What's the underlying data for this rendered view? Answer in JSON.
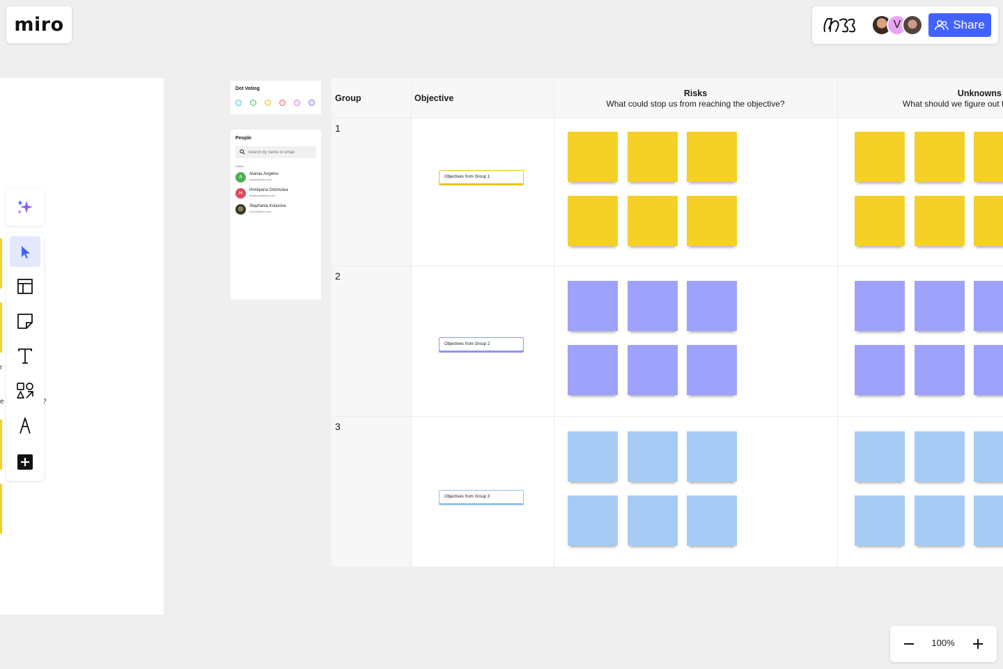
{
  "app": {
    "logo_text": "miro"
  },
  "colors": {
    "accent": "#4262ff",
    "sticky_yellow": "#f5d128",
    "sticky_purple": "#9ea2fa",
    "sticky_blue": "#a6ccf5",
    "canvas_bg": "#efefef"
  },
  "header": {
    "board_icon": "board-doodle-icon",
    "collaborators": [
      {
        "name": "collaborator-1",
        "initial": ""
      },
      {
        "name": "collaborator-2",
        "initial": "V"
      },
      {
        "name": "collaborator-3",
        "initial": ""
      }
    ],
    "share_label": "Share",
    "share_icon": "people-icon"
  },
  "toolbar": {
    "ai_icon": "sparkle-icon",
    "tools": [
      {
        "name": "select-tool",
        "icon": "cursor-icon",
        "active": true
      },
      {
        "name": "templates-tool",
        "icon": "template-icon",
        "active": false
      },
      {
        "name": "sticky-note-tool",
        "icon": "sticky-note-icon",
        "active": false
      },
      {
        "name": "text-tool",
        "icon": "text-icon",
        "active": false
      },
      {
        "name": "shapes-tool",
        "icon": "shapes-icon",
        "active": false
      },
      {
        "name": "pen-tool",
        "icon": "pen-icon",
        "active": false
      },
      {
        "name": "more-tools",
        "icon": "plus-square-icon",
        "active": false
      }
    ]
  },
  "left_frame": {
    "fragment_1": "r",
    "fragment_2": "e s",
    "fragment_3": "?"
  },
  "dot_voting": {
    "title": "Dot Voting",
    "dots": [
      "#5bc0de",
      "#4cbf6b",
      "#e0c229",
      "#ef6b6b",
      "#e07be0",
      "#7b7bef"
    ]
  },
  "people": {
    "title": "People",
    "search_placeholder": "Search by name or email",
    "online_label": "Online",
    "list": [
      {
        "initial": "A",
        "name": "Atanas Angelov",
        "email": "atanas@miro.com",
        "color": "#4cb050"
      },
      {
        "initial": "H",
        "name": "Hristiyana Ostrovska",
        "email": "hristiyana@miro.com",
        "color": "#e0485e"
      },
      {
        "initial": "",
        "name": "Stephania Kolarova",
        "email": "s1212@miro.com",
        "color": "#3a4a2a"
      }
    ]
  },
  "table": {
    "headers": {
      "group": "Group",
      "objective": "Objective",
      "risks_title": "Risks",
      "risks_sub": "What could stop us from reaching the objective?",
      "unknowns_title": "Unknowns",
      "unknowns_sub": "What should we figure out to"
    },
    "rows": [
      {
        "num": "1",
        "objective": "Objectives from Group 1",
        "color": "yellow",
        "border": "#f0c419"
      },
      {
        "num": "2",
        "objective": "Objectives from Group 2",
        "color": "purple",
        "border": "#8f95f4"
      },
      {
        "num": "3",
        "objective": "Objectives from Group 3",
        "color": "blue",
        "border": "#93bfef"
      }
    ]
  },
  "zoom": {
    "value": "100%"
  }
}
